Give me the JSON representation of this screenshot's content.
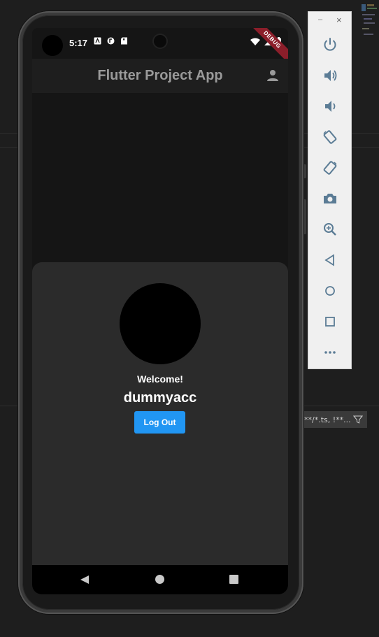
{
  "status_bar": {
    "time": "5:17"
  },
  "debug_banner": "DEBUG",
  "app_bar": {
    "title": "Flutter Project App"
  },
  "profile": {
    "welcome": "Welcome!",
    "username": "dummyacc",
    "logout_label": "Log Out"
  },
  "ide": {
    "filter_text": "**/*.ts, !**..."
  },
  "emulator_toolbar": {
    "minimize": "–",
    "close": "×"
  },
  "colors": {
    "accent_button": "#2196f3",
    "debug_ribbon": "#8b1e2a",
    "toolbar_icon": "#5b7c95"
  }
}
